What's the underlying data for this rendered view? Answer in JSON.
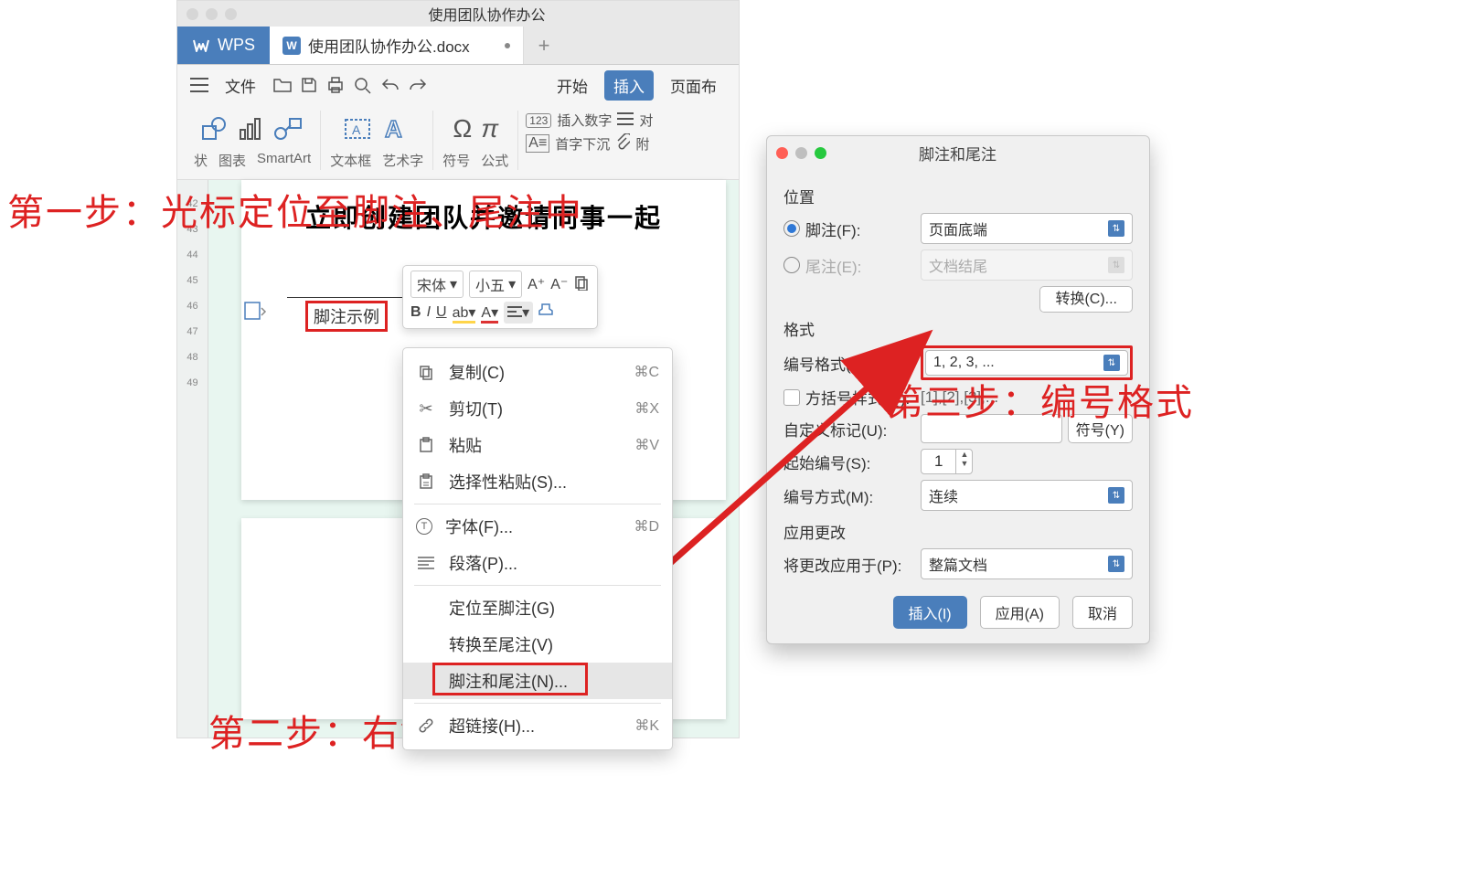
{
  "annotations": {
    "step1": "第一步：光标定位至脚注、尾注中",
    "step2": "第二步：右键-\"脚注和尾注\"",
    "step3": "第三步：编号格式"
  },
  "window": {
    "title": "使用团队协作办公",
    "brand": "WPS",
    "doc_tab": "使用团队协作办公.docx",
    "menus": {
      "file": "文件",
      "start": "开始",
      "insert": "插入",
      "page": "页面布"
    },
    "ribbon": {
      "shape": "状",
      "chart": "图表",
      "smartart": "SmartArt",
      "textbox": "文本框",
      "wordart": "艺术字",
      "symbol": "符号",
      "formula": "公式",
      "ins_num": "插入数字",
      "align": "对",
      "dropcap": "首字下沉",
      "attach": "附"
    },
    "doc": {
      "heading": "立即创建团队并邀请同事一起",
      "footnote_label": "脚注示例"
    },
    "ruler": [
      "42",
      "43",
      "44",
      "45",
      "46",
      "47",
      "48",
      "49"
    ],
    "mini": {
      "font": "宋体",
      "size": "小五",
      "a_plus": "A⁺",
      "a_minus": "A⁻"
    },
    "ctx": {
      "copy": "复制(C)",
      "copy_k": "⌘C",
      "cut": "剪切(T)",
      "cut_k": "⌘X",
      "paste": "粘贴",
      "paste_k": "⌘V",
      "paste_sp": "选择性粘贴(S)...",
      "font": "字体(F)...",
      "font_k": "⌘D",
      "para": "段落(P)...",
      "goto_fn": "定位至脚注(G)",
      "to_en": "转换至尾注(V)",
      "fn_en": "脚注和尾注(N)...",
      "link": "超链接(H)...",
      "link_k": "⌘K"
    }
  },
  "dialog": {
    "title": "脚注和尾注",
    "section_pos": "位置",
    "footnote_lbl": "脚注(F):",
    "footnote_val": "页面底端",
    "endnote_lbl": "尾注(E):",
    "endnote_val": "文档结尾",
    "convert": "转换(C)...",
    "section_fmt": "格式",
    "numfmt_lbl": "编号格式(N):",
    "numfmt_val": "1, 2, 3, ...",
    "bracket_lbl": "方括号样式(Q):",
    "bracket_val": "[1],[2],[3],...",
    "custom_lbl": "自定义标记(U):",
    "symbol_btn": "符号(Y)",
    "start_lbl": "起始编号(S):",
    "start_val": "1",
    "mode_lbl": "编号方式(M):",
    "mode_val": "连续",
    "section_apply": "应用更改",
    "applyto_lbl": "将更改应用于(P):",
    "applyto_val": "整篇文档",
    "btn_insert": "插入(I)",
    "btn_apply": "应用(A)",
    "btn_cancel": "取消"
  }
}
